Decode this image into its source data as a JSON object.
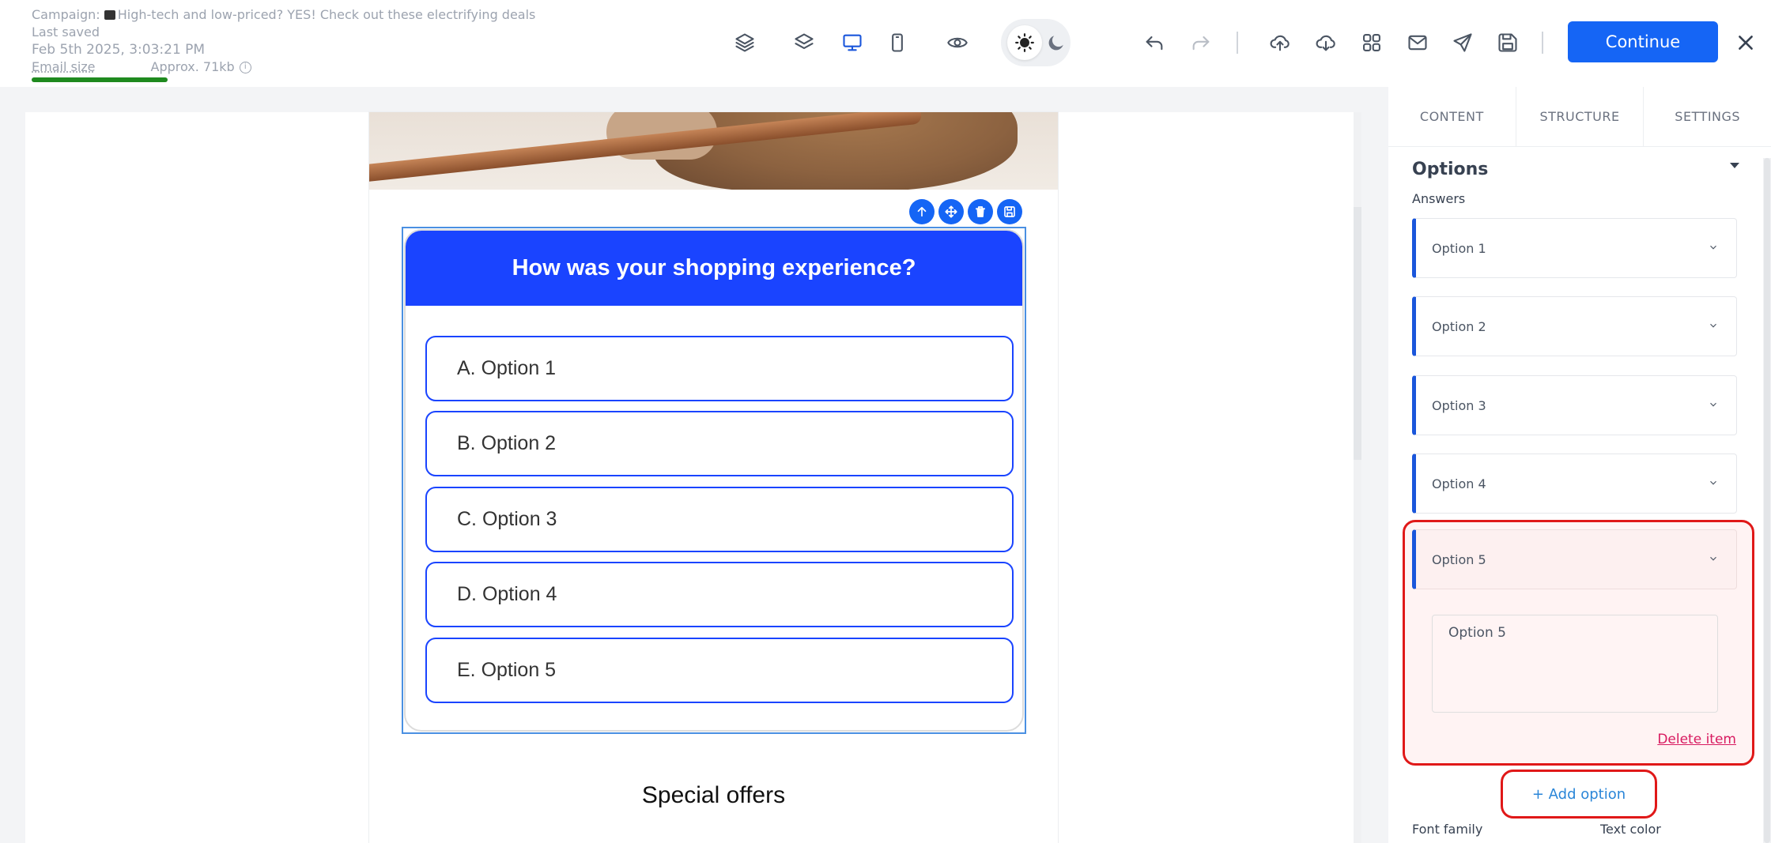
{
  "header": {
    "campaign_prefix": "Campaign:",
    "campaign_name": "High-tech and low-priced? YES! Check out these electrifying deals",
    "last_saved_label": "Last saved",
    "last_saved_time": "Feb 5th 2025, 3:03:21 PM",
    "email_size_label": "Email size",
    "email_size_value": "Approx. 71kb",
    "email_size_info": "i",
    "continue_label": "Continue",
    "close_label": "✕",
    "toolbar_icons": [
      "layers-outline-icon",
      "layers-icon",
      "desktop-icon",
      "mobile-icon",
      "eye-icon",
      "sun-icon",
      "moon-icon",
      "undo-icon",
      "redo-icon",
      "upload-icon",
      "download-icon",
      "grid-icon",
      "mail-icon",
      "send-icon",
      "save-icon"
    ]
  },
  "email": {
    "poll_question": "How was your shopping experience?",
    "options": [
      "A. Option 1",
      "B. Option 2",
      "C. Option 3",
      "D. Option 4",
      "E. Option 5"
    ],
    "section_heading": "Special offers",
    "block_tool_icons": [
      "move-up-icon",
      "drag-icon",
      "delete-icon",
      "save-block-icon"
    ]
  },
  "panel": {
    "tabs": [
      "CONTENT",
      "STRUCTURE",
      "SETTINGS"
    ],
    "section_title": "Options",
    "answers_label": "Answers",
    "answers": [
      "Option 1",
      "Option 2",
      "Option 3",
      "Option 4",
      "Option 5"
    ],
    "expanded_value": "Option 5",
    "delete_label": "Delete item",
    "add_option_label": "+ Add option",
    "font_family_label": "Font family",
    "text_color_label": "Text color"
  },
  "colors": {
    "accent": "#1565f5",
    "poll_blue": "#1a44ff",
    "highlight_red": "#e01818",
    "size_bar_green": "#1f8a1f"
  }
}
